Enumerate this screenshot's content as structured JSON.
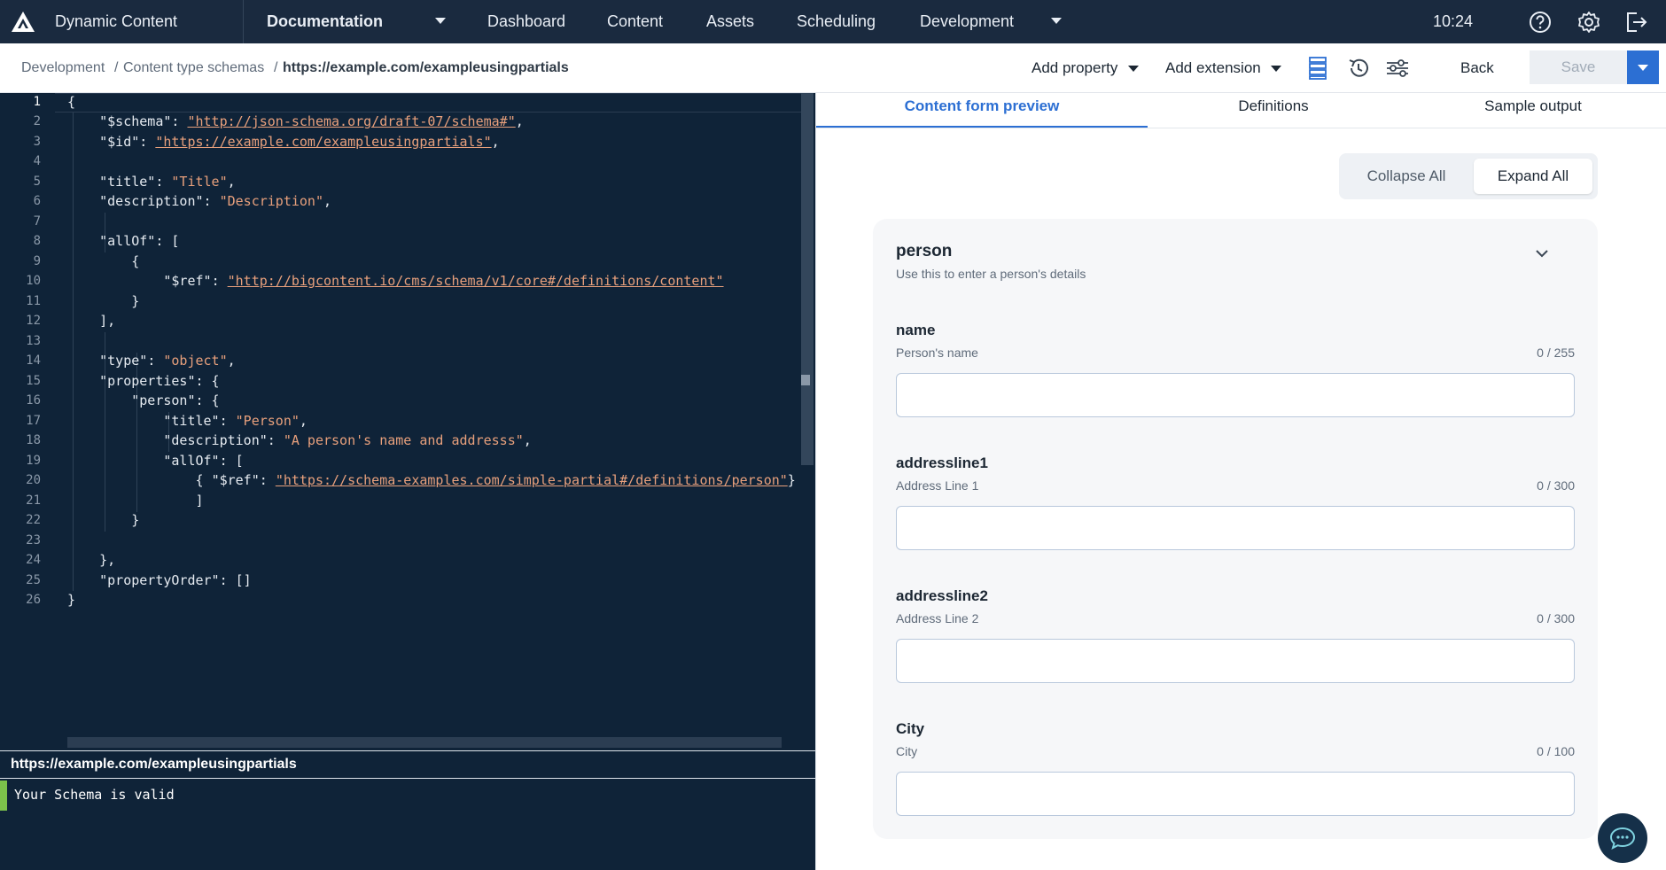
{
  "nav": {
    "app_name": "Dynamic Content",
    "hub": "Documentation",
    "items": [
      "Dashboard",
      "Content",
      "Assets",
      "Scheduling",
      "Development"
    ],
    "time": "10:24"
  },
  "breadcrumb": {
    "items": [
      "Development",
      "Content type schemas"
    ],
    "current": "https://example.com/exampleusingpartials"
  },
  "toolbar": {
    "add_property": "Add property",
    "add_extension": "Add extension",
    "back": "Back",
    "save": "Save"
  },
  "editor": {
    "line_numbers": [
      "1",
      "2",
      "3",
      "4",
      "5",
      "6",
      "7",
      "8",
      "9",
      "10",
      "11",
      "12",
      "13",
      "14",
      "15",
      "16",
      "17",
      "18",
      "19",
      "20",
      "21",
      "22",
      "23",
      "24",
      "25",
      "26"
    ],
    "schema_key": "\"$schema\"",
    "schema_url": "\"http://json-schema.org/draft-07/schema#\"",
    "id_key": "\"$id\"",
    "id_url": "\"https://example.com/exampleusingpartials\"",
    "title_key": "\"title\"",
    "title_val": "\"Title\"",
    "desc_key": "\"description\"",
    "desc_val": "\"Description\"",
    "allof_key": "\"allOf\"",
    "ref_key": "\"$ref\"",
    "ref_url": "\"http://bigcontent.io/cms/schema/v1/core#/definitions/content\"",
    "type_key": "\"type\"",
    "type_val": "\"object\"",
    "props_key": "\"properties\"",
    "person_key": "\"person\"",
    "p_title_val": "\"Person\"",
    "p_desc_val": "\"A person's name and addresss\"",
    "p_ref_url": "\"https://schema-examples.com/simple-partial#/definitions/person\"",
    "order_key": "\"propertyOrder\""
  },
  "status": {
    "url": "https://example.com/exampleusingpartials",
    "message": "Your Schema is valid",
    "color": "#7cc24b"
  },
  "tabs": [
    "Content form preview",
    "Definitions",
    "Sample output"
  ],
  "toggle": {
    "collapse": "Collapse All",
    "expand": "Expand All"
  },
  "form": {
    "title": "person",
    "subtitle": "Use this to enter a person's details",
    "fields": [
      {
        "label": "name",
        "desc": "Person's name",
        "count": "0 / 255"
      },
      {
        "label": "addressline1",
        "desc": "Address Line 1",
        "count": "0 / 300"
      },
      {
        "label": "addressline2",
        "desc": "Address Line 2",
        "count": "0 / 300"
      },
      {
        "label": "City",
        "desc": "City",
        "count": "0 / 100"
      }
    ]
  },
  "colors": {
    "nav_bg": "#1a2a3f",
    "editor_bg": "#0f2338",
    "accent": "#2c6fd3",
    "string": "#e8a07c"
  }
}
